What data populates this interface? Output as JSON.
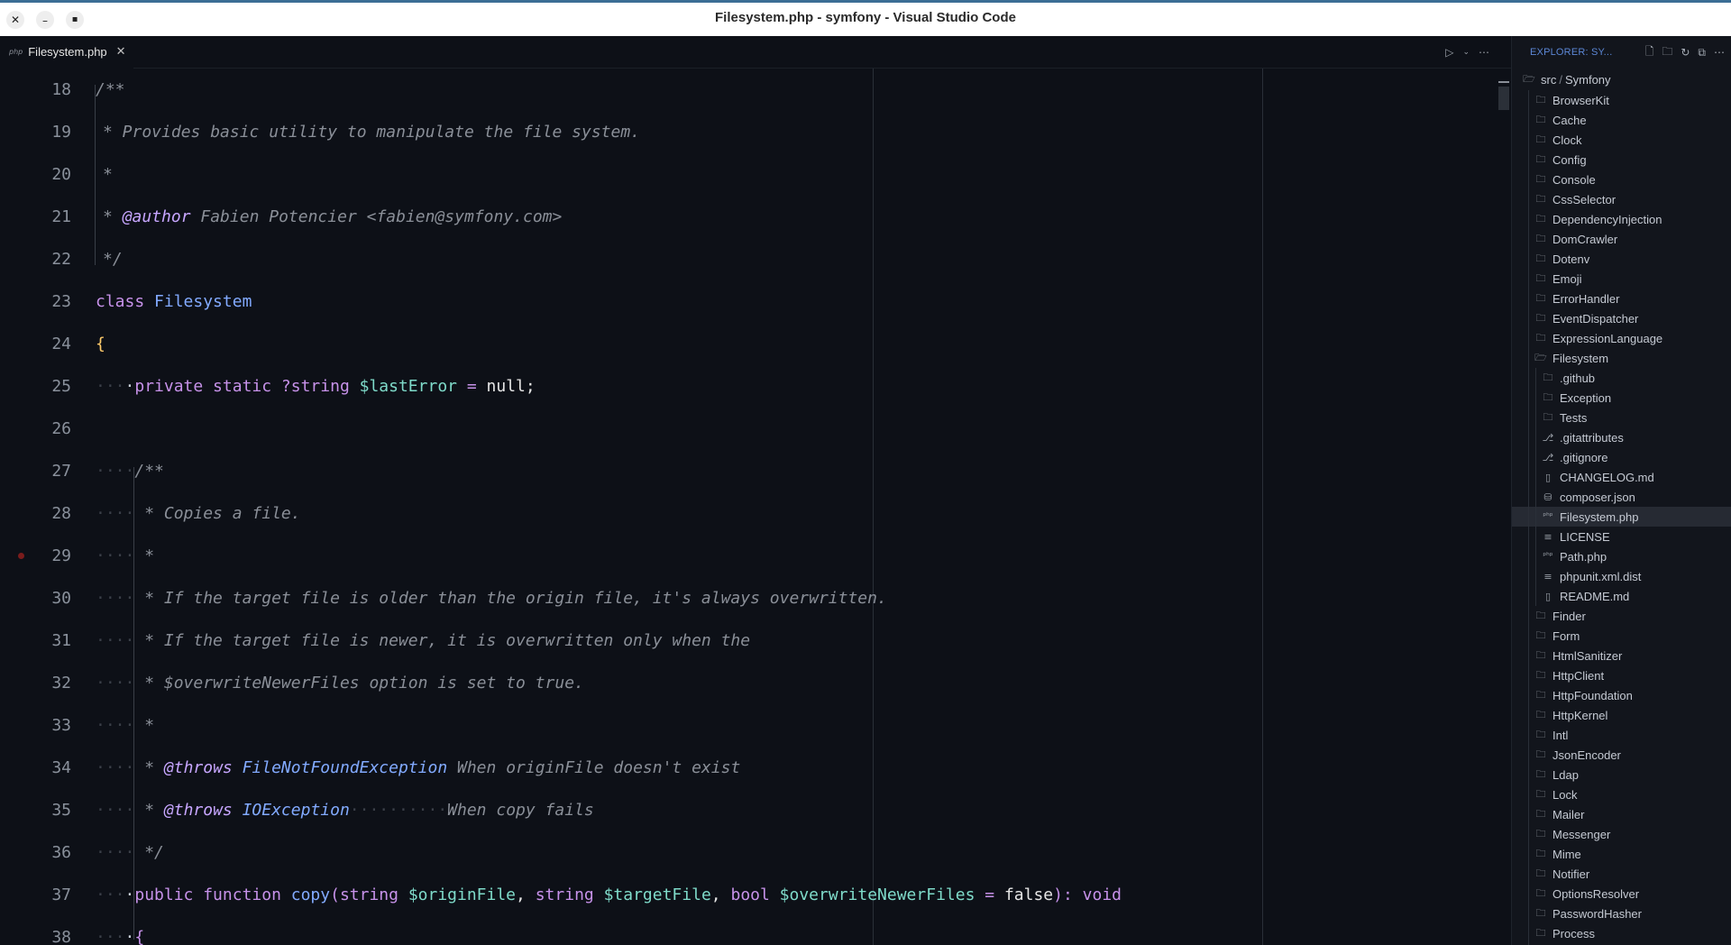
{
  "window": {
    "title": "Filesystem.php - symfony - Visual Studio Code",
    "close_glyph": "✕",
    "minimize_glyph": "–",
    "maximize_glyph": "▪"
  },
  "tabs": [
    {
      "label": "Filesystem.php",
      "icon": "php-file-icon",
      "icon_text": "php",
      "active": true
    }
  ],
  "editor": {
    "breakpoint_line": 29,
    "lines": [
      {
        "n": "18"
      },
      {
        "n": "19"
      },
      {
        "n": "20"
      },
      {
        "n": "21"
      },
      {
        "n": "22"
      },
      {
        "n": "23"
      },
      {
        "n": "24"
      },
      {
        "n": "25"
      },
      {
        "n": "26"
      },
      {
        "n": "27"
      },
      {
        "n": "28"
      },
      {
        "n": "29"
      },
      {
        "n": "30"
      },
      {
        "n": "31"
      },
      {
        "n": "32"
      },
      {
        "n": "33"
      },
      {
        "n": "34"
      },
      {
        "n": "35"
      },
      {
        "n": "36"
      },
      {
        "n": "37"
      },
      {
        "n": "38"
      }
    ],
    "text": {
      "l18": "/**",
      "l19": "* Provides basic utility to manipulate the file system.",
      "l20": "*",
      "l21a": "* ",
      "l21b": "@author",
      "l21c": " Fabien Potencier <fabien@symfony.com>",
      "l22": "*/",
      "l23a": "class ",
      "l23b": "Filesystem",
      "l24": "{",
      "l25a": "private static ",
      "l25b": "?string ",
      "l25c": "$lastError",
      "l25d": " = ",
      "l25e": "null;",
      "l27": "/**",
      "l28": "* Copies a file.",
      "l29": "*",
      "l30": "* If the target file is older than the origin file, it's always overwritten.",
      "l31": "* If the target file is newer, it is overwritten only when the",
      "l32": "* $overwriteNewerFiles option is set to true.",
      "l33": "*",
      "l34a": "* ",
      "l34b": "@throws",
      "l34c": " FileNotFoundException",
      "l34d": " When originFile doesn't exist",
      "l35a": "* ",
      "l35b": "@throws",
      "l35c": " IOException",
      "l35d": "··········",
      "l35e": "When copy fails",
      "l36": "*/",
      "l37a": "public function ",
      "l37b": "copy",
      "l37c": "(",
      "l37d": "string ",
      "l37e": "$originFile",
      "l37f": ", ",
      "l37g": "string ",
      "l37h": "$targetFile",
      "l37i": ", ",
      "l37j": "bool ",
      "l37k": "$overwriteNewerFiles",
      "l37l": " = ",
      "l37m": "false",
      "l37n": "): ",
      "l37o": "void",
      "l38": "{",
      "indent1": "···",
      "indent2": "····"
    }
  },
  "explorer": {
    "title": "EXPLORER: SY...",
    "breadcrumb": [
      "src",
      "Symfony"
    ],
    "items": [
      {
        "label": "BrowserKit",
        "type": "folder",
        "depth": 1
      },
      {
        "label": "Cache",
        "type": "folder",
        "depth": 1
      },
      {
        "label": "Clock",
        "type": "folder",
        "depth": 1
      },
      {
        "label": "Config",
        "type": "folder",
        "depth": 1
      },
      {
        "label": "Console",
        "type": "folder",
        "depth": 1
      },
      {
        "label": "CssSelector",
        "type": "folder",
        "depth": 1
      },
      {
        "label": "DependencyInjection",
        "type": "folder",
        "depth": 1
      },
      {
        "label": "DomCrawler",
        "type": "folder",
        "depth": 1
      },
      {
        "label": "Dotenv",
        "type": "folder",
        "depth": 1
      },
      {
        "label": "Emoji",
        "type": "folder",
        "depth": 1
      },
      {
        "label": "ErrorHandler",
        "type": "folder",
        "depth": 1
      },
      {
        "label": "EventDispatcher",
        "type": "folder",
        "depth": 1
      },
      {
        "label": "ExpressionLanguage",
        "type": "folder",
        "depth": 1
      },
      {
        "label": "Filesystem",
        "type": "folder-open",
        "depth": 1
      },
      {
        "label": ".github",
        "type": "folder",
        "depth": 2
      },
      {
        "label": "Exception",
        "type": "folder",
        "depth": 2
      },
      {
        "label": "Tests",
        "type": "folder",
        "depth": 2
      },
      {
        "label": ".gitattributes",
        "type": "git",
        "depth": 2
      },
      {
        "label": ".gitignore",
        "type": "git",
        "depth": 2
      },
      {
        "label": "CHANGELOG.md",
        "type": "book",
        "depth": 2
      },
      {
        "label": "composer.json",
        "type": "db",
        "depth": 2
      },
      {
        "label": "Filesystem.php",
        "type": "php",
        "depth": 2,
        "selected": true
      },
      {
        "label": "LICENSE",
        "type": "lines",
        "depth": 2
      },
      {
        "label": "Path.php",
        "type": "php",
        "depth": 2
      },
      {
        "label": "phpunit.xml.dist",
        "type": "lines",
        "depth": 2
      },
      {
        "label": "README.md",
        "type": "book",
        "depth": 2
      },
      {
        "label": "Finder",
        "type": "folder",
        "depth": 1
      },
      {
        "label": "Form",
        "type": "folder",
        "depth": 1
      },
      {
        "label": "HtmlSanitizer",
        "type": "folder",
        "depth": 1
      },
      {
        "label": "HttpClient",
        "type": "folder",
        "depth": 1
      },
      {
        "label": "HttpFoundation",
        "type": "folder",
        "depth": 1
      },
      {
        "label": "HttpKernel",
        "type": "folder",
        "depth": 1
      },
      {
        "label": "Intl",
        "type": "folder",
        "depth": 1
      },
      {
        "label": "JsonEncoder",
        "type": "folder",
        "depth": 1
      },
      {
        "label": "Ldap",
        "type": "folder",
        "depth": 1
      },
      {
        "label": "Lock",
        "type": "folder",
        "depth": 1
      },
      {
        "label": "Mailer",
        "type": "folder",
        "depth": 1
      },
      {
        "label": "Messenger",
        "type": "folder",
        "depth": 1
      },
      {
        "label": "Mime",
        "type": "folder",
        "depth": 1
      },
      {
        "label": "Notifier",
        "type": "folder",
        "depth": 1
      },
      {
        "label": "OptionsResolver",
        "type": "folder",
        "depth": 1
      },
      {
        "label": "PasswordHasher",
        "type": "folder",
        "depth": 1
      },
      {
        "label": "Process",
        "type": "folder",
        "depth": 1
      }
    ]
  },
  "colors": {
    "background": "#0d1017",
    "sidebar": "#12151c",
    "keyword": "#c792ea",
    "class": "#82aaff",
    "variable": "#7fdbca",
    "comment": "#8a8f98",
    "brace": "#ffcb6b",
    "breakpoint": "#7a1c1c",
    "explorer_title": "#5c87d6"
  }
}
